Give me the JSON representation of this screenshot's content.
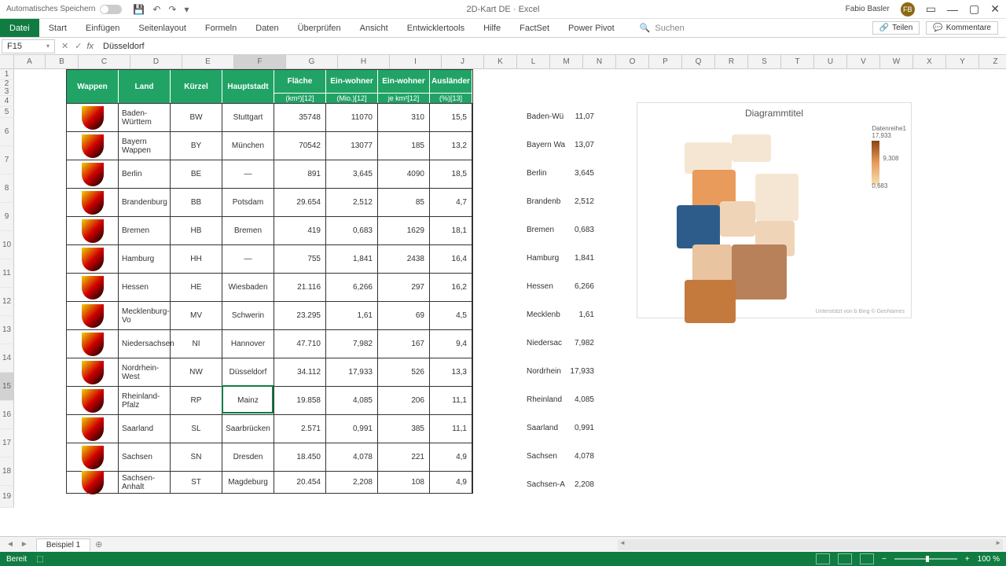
{
  "titlebar": {
    "autosave": "Automatisches Speichern",
    "doc": "2D-Kart DE",
    "app": "Excel",
    "user": "Fabio Basler",
    "initials": "FB"
  },
  "ribbon": {
    "tabs": [
      "Datei",
      "Start",
      "Einfügen",
      "Seitenlayout",
      "Formeln",
      "Daten",
      "Überprüfen",
      "Ansicht",
      "Entwicklertools",
      "Hilfe",
      "FactSet",
      "Power Pivot"
    ],
    "search": "Suchen",
    "share": "Teilen",
    "comments": "Kommentare"
  },
  "formula": {
    "cell": "F15",
    "value": "Düsseldorf"
  },
  "columns": [
    "A",
    "B",
    "C",
    "D",
    "E",
    "F",
    "G",
    "H",
    "I",
    "J",
    "K",
    "L",
    "M",
    "N",
    "O",
    "P",
    "Q",
    "R",
    "S",
    "T",
    "U",
    "V",
    "W",
    "X",
    "Y",
    "Z"
  ],
  "table": {
    "headers": {
      "wappen": "Wappen",
      "land": "Land",
      "kuerzel": "Kürzel",
      "hauptstadt": "Hauptstadt",
      "flaeche": "Fläche",
      "flaeche_sub": "(km²)[12]",
      "einwohner_mio": "Ein-wohner",
      "einwohner_mio_sub": "(Mio.)[12]",
      "einwohner_km": "Ein-wohner",
      "einwohner_km_sub": "je km²[12]",
      "auslaender": "Ausländer",
      "auslaender_sub": "(%)[13]"
    },
    "rows": [
      {
        "land": "Baden-Württem",
        "k": "BW",
        "h": "Stuttgart",
        "f": "35748",
        "em": "11070",
        "ek": "310",
        "a": "15,5"
      },
      {
        "land": "Bayern Wappen",
        "k": "BY",
        "h": "München",
        "f": "70542",
        "em": "13077",
        "ek": "185",
        "a": "13,2"
      },
      {
        "land": "Berlin",
        "k": "BE",
        "h": "—",
        "f": "891",
        "em": "3,645",
        "ek": "4090",
        "a": "18,5"
      },
      {
        "land": "Brandenburg",
        "k": "BB",
        "h": "Potsdam",
        "f": "29.654",
        "em": "2,512",
        "ek": "85",
        "a": "4,7"
      },
      {
        "land": "Bremen",
        "k": "HB",
        "h": "Bremen",
        "f": "419",
        "em": "0,683",
        "ek": "1629",
        "a": "18,1"
      },
      {
        "land": "Hamburg",
        "k": "HH",
        "h": "—",
        "f": "755",
        "em": "1,841",
        "ek": "2438",
        "a": "16,4"
      },
      {
        "land": "Hessen",
        "k": "HE",
        "h": "Wiesbaden",
        "f": "21.116",
        "em": "6,266",
        "ek": "297",
        "a": "16,2"
      },
      {
        "land": "Mecklenburg-Vo",
        "k": "MV",
        "h": "Schwerin",
        "f": "23.295",
        "em": "1,61",
        "ek": "69",
        "a": "4,5"
      },
      {
        "land": "Niedersachsen",
        "k": "NI",
        "h": "Hannover",
        "f": "47.710",
        "em": "7,982",
        "ek": "167",
        "a": "9,4"
      },
      {
        "land": "Nordrhein-West",
        "k": "NW",
        "h": "Düsseldorf",
        "f": "34.112",
        "em": "17,933",
        "ek": "526",
        "a": "13,3"
      },
      {
        "land": "Rheinland-Pfalz",
        "k": "RP",
        "h": "Mainz",
        "f": "19.858",
        "em": "4,085",
        "ek": "206",
        "a": "11,1"
      },
      {
        "land": "Saarland",
        "k": "SL",
        "h": "Saarbrücken",
        "f": "2.571",
        "em": "0,991",
        "ek": "385",
        "a": "11,1"
      },
      {
        "land": "Sachsen",
        "k": "SN",
        "h": "Dresden",
        "f": "18.450",
        "em": "4,078",
        "ek": "221",
        "a": "4,9"
      },
      {
        "land": "Sachsen-Anhalt",
        "k": "ST",
        "h": "Magdeburg",
        "f": "20.454",
        "em": "2,208",
        "ek": "108",
        "a": "4,9"
      }
    ]
  },
  "sidelist": [
    {
      "n": "Baden-Wü",
      "v": "11,07"
    },
    {
      "n": "Bayern Wa",
      "v": "13,07"
    },
    {
      "n": "Berlin",
      "v": "3,645"
    },
    {
      "n": "Brandenb",
      "v": "2,512"
    },
    {
      "n": "Bremen",
      "v": "0,683"
    },
    {
      "n": "Hamburg",
      "v": "1,841"
    },
    {
      "n": "Hessen",
      "v": "6,266"
    },
    {
      "n": "Mecklenb",
      "v": "1,61"
    },
    {
      "n": "Niedersac",
      "v": "7,982"
    },
    {
      "n": "Nordrhein",
      "v": "17,933"
    },
    {
      "n": "Rheinland",
      "v": "4,085"
    },
    {
      "n": "Saarland",
      "v": "0,991"
    },
    {
      "n": "Sachsen",
      "v": "4,078"
    },
    {
      "n": "Sachsen-A",
      "v": "2,208"
    }
  ],
  "chart": {
    "title": "Diagrammtitel",
    "series": "Datenreihe1",
    "legend": {
      "max": "17,933",
      "mid": "9,308",
      "min": "0,683"
    },
    "credit": "Unterstützt von b Bing © GeoNames"
  },
  "chart_data": {
    "type": "map",
    "title": "Diagrammtitel",
    "series": [
      {
        "name": "Datenreihe1",
        "regions": [
          {
            "name": "Baden-Württemberg",
            "value": 11.07
          },
          {
            "name": "Bayern",
            "value": 13.07
          },
          {
            "name": "Berlin",
            "value": 3.645
          },
          {
            "name": "Brandenburg",
            "value": 2.512
          },
          {
            "name": "Bremen",
            "value": 0.683
          },
          {
            "name": "Hamburg",
            "value": 1.841
          },
          {
            "name": "Hessen",
            "value": 6.266
          },
          {
            "name": "Mecklenburg-Vorpommern",
            "value": 1.61
          },
          {
            "name": "Niedersachsen",
            "value": 7.982
          },
          {
            "name": "Nordrhein-Westfalen",
            "value": 17.933
          },
          {
            "name": "Rheinland-Pfalz",
            "value": 4.085
          },
          {
            "name": "Saarland",
            "value": 0.991
          },
          {
            "name": "Sachsen",
            "value": 4.078
          },
          {
            "name": "Sachsen-Anhalt",
            "value": 2.208
          }
        ]
      }
    ],
    "color_scale": {
      "min": 0.683,
      "mid": 9.308,
      "max": 17.933
    }
  },
  "sheet": {
    "name": "Beispiel 1"
  },
  "status": {
    "ready": "Bereit",
    "zoom": "100 %"
  }
}
